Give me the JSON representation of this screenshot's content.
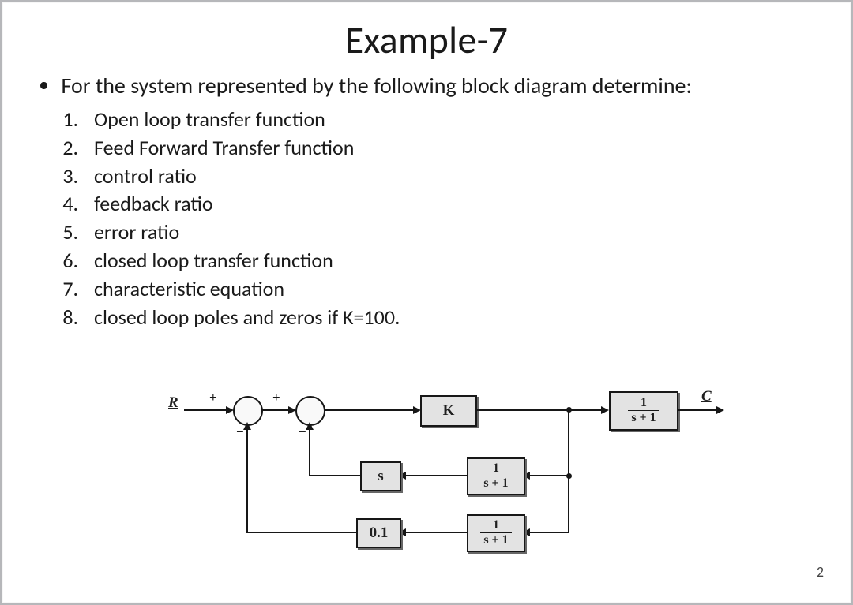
{
  "title": "Example-7",
  "bullet_text": "For the system represented by the following block diagram determine:",
  "items": [
    "Open loop transfer function",
    "Feed Forward Transfer function",
    "control ratio",
    "feedback ratio",
    "error ratio",
    "closed loop transfer function",
    "characteristic equation",
    "closed loop poles and zeros if K=100."
  ],
  "slide_number": "2",
  "diagram": {
    "input_label": "R",
    "output_label": "C",
    "sum1": {
      "top_sign": "+",
      "bottom_sign": "−"
    },
    "sum2": {
      "top_sign": "+",
      "bottom_sign": "−"
    },
    "block_forward_1": "K",
    "block_forward_2": {
      "num": "1",
      "den": "s + 1"
    },
    "feedback_inner": {
      "block_a": "s",
      "block_b": {
        "num": "1",
        "den": "s + 1"
      }
    },
    "feedback_outer": {
      "block_a": "0.1",
      "block_b": {
        "num": "1",
        "den": "s + 1"
      }
    }
  }
}
